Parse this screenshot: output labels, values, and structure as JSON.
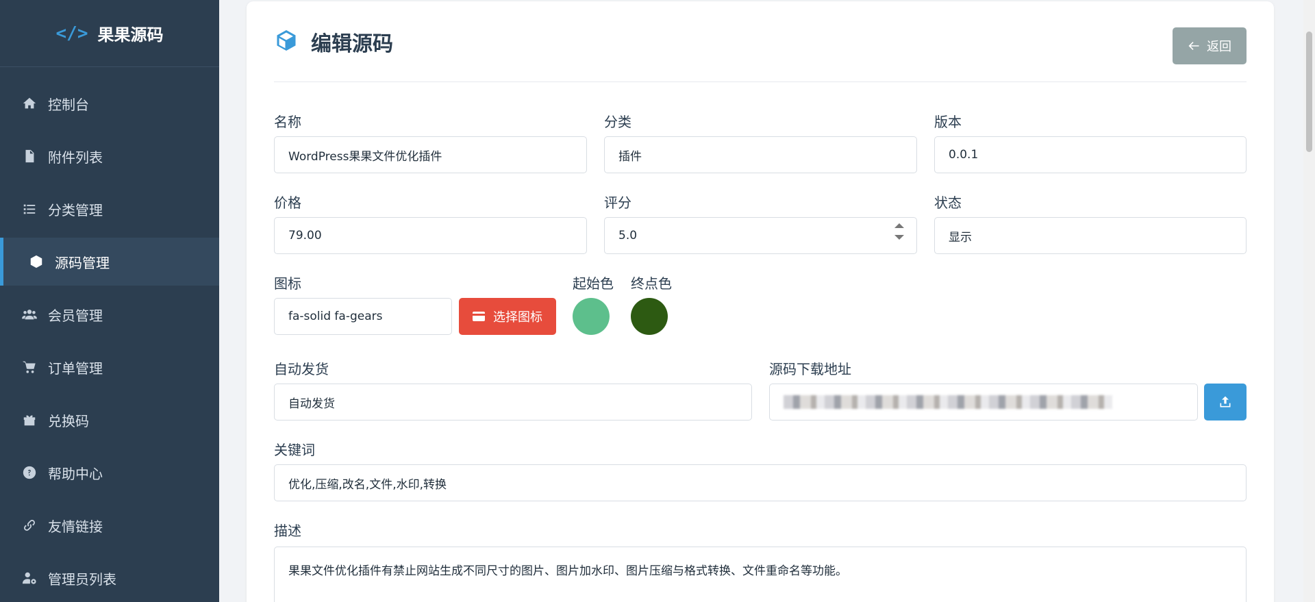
{
  "brand": {
    "icon": "code-icon",
    "icon_glyph": "</>",
    "title": "果果源码"
  },
  "sidebar": {
    "items": [
      {
        "label": "控制台",
        "icon": "home-icon"
      },
      {
        "label": "附件列表",
        "icon": "file-icon"
      },
      {
        "label": "分类管理",
        "icon": "list-icon"
      },
      {
        "label": "源码管理",
        "icon": "cube-icon",
        "active": true
      },
      {
        "label": "会员管理",
        "icon": "users-icon"
      },
      {
        "label": "订单管理",
        "icon": "cart-icon"
      },
      {
        "label": "兑换码",
        "icon": "gift-icon"
      },
      {
        "label": "帮助中心",
        "icon": "question-icon"
      },
      {
        "label": "友情链接",
        "icon": "link-icon"
      },
      {
        "label": "管理员列表",
        "icon": "user-gear-icon"
      }
    ]
  },
  "header": {
    "title": "编辑源码",
    "icon": "cube-icon",
    "back_label": "返回"
  },
  "form": {
    "name": {
      "label": "名称",
      "value": "WordPress果果文件优化插件"
    },
    "category": {
      "label": "分类",
      "value": "插件"
    },
    "version": {
      "label": "版本",
      "value": "0.0.1"
    },
    "price": {
      "label": "价格",
      "value": "79.00"
    },
    "rating": {
      "label": "评分",
      "value": "5.0"
    },
    "status": {
      "label": "状态",
      "value": "显示"
    },
    "icon": {
      "label": "图标",
      "value": "fa-solid fa-gears",
      "choose_label": "选择图标"
    },
    "start_color": {
      "label": "起始色",
      "value": "#5dbf8c"
    },
    "end_color": {
      "label": "终点色",
      "value": "#2d5a12"
    },
    "auto_delivery": {
      "label": "自动发货",
      "value": "自动发货"
    },
    "download_url": {
      "label": "源码下载地址"
    },
    "keywords": {
      "label": "关键词",
      "value": "优化,压缩,改名,文件,水印,转换"
    },
    "description": {
      "label": "描述",
      "value": "果果文件优化插件有禁止网站生成不同尺寸的图片、图片加水印、图片压缩与格式转换、文件重命名等功能。"
    }
  },
  "colors": {
    "sidebar_bg": "#2c3e50",
    "accent": "#3a9ad9",
    "danger": "#e74c3c",
    "muted": "#95a5a6"
  }
}
